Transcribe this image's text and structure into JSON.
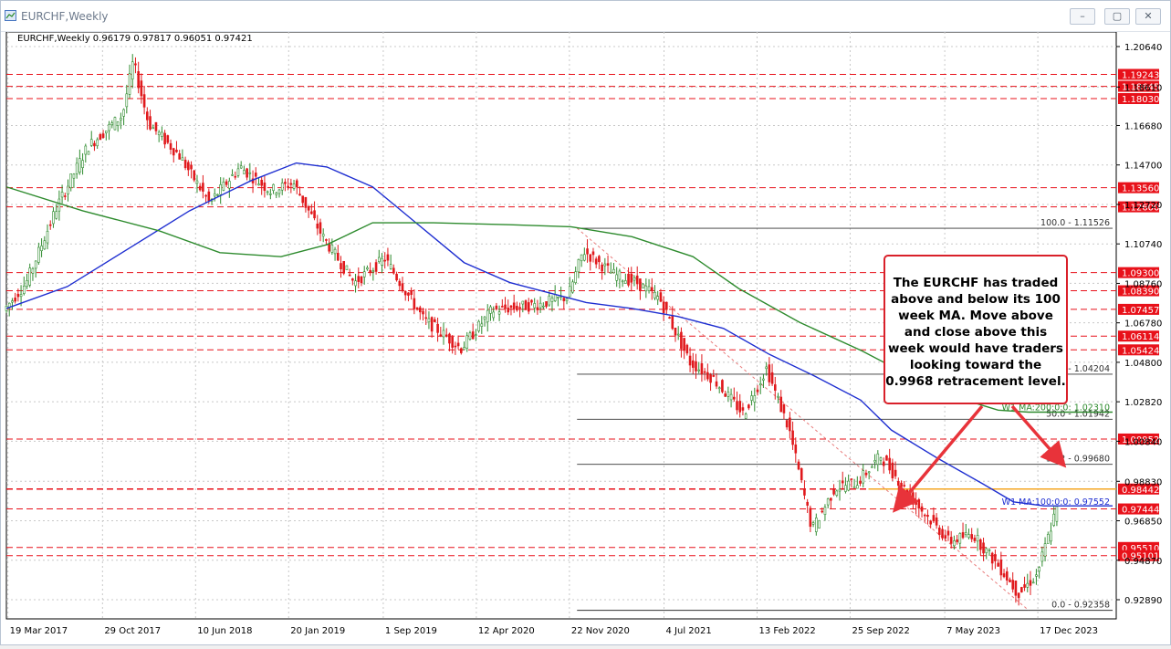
{
  "window": {
    "title": "EURCHF,Weekly",
    "minimize_label": "–",
    "maximize_label": "▢",
    "close_label": "✕"
  },
  "chart_data": {
    "type": "candlestick",
    "symbol_header": "EURCHF,Weekly  0.96179 0.97817 0.96051 0.97421",
    "ylim": [
      0.915,
      1.212
    ],
    "grid": true,
    "y_ticks": [
      "1.20640",
      "1.18610",
      "1.16680",
      "1.14700",
      "1.12720",
      "1.10740",
      "1.08760",
      "1.06780",
      "1.04800",
      "1.02820",
      "1.00840",
      "0.98830",
      "0.96850",
      "0.94870",
      "0.92890"
    ],
    "y_tick_values": [
      1.2064,
      1.1861,
      1.1668,
      1.147,
      1.1272,
      1.1074,
      1.0876,
      1.0678,
      1.048,
      1.0282,
      1.0084,
      0.9883,
      0.9685,
      0.9487,
      0.9289
    ],
    "x_ticks": [
      "19 Mar 2017",
      "29 Oct 2017",
      "10 Jun 2018",
      "20 Jan 2019",
      "1 Sep 2019",
      "12 Apr 2020",
      "22 Nov 2020",
      "4 Jul 2021",
      "13 Feb 2022",
      "25 Sep 2022",
      "7 May 2023",
      "17 Dec 2023"
    ],
    "x_tick_values": [
      2017.21,
      2017.83,
      2018.44,
      2019.05,
      2019.67,
      2020.28,
      2020.89,
      2021.51,
      2022.12,
      2022.73,
      2023.35,
      2023.96
    ],
    "x_range": [
      2017.2,
      2024.45
    ],
    "horizontal_levels": [
      {
        "label": "1.19243",
        "value": 1.19243
      },
      {
        "label": "1.18645",
        "value": 1.18645
      },
      {
        "label": "1.18030",
        "value": 1.1803
      },
      {
        "label": "1.13560",
        "value": 1.1356
      },
      {
        "label": "1.12600",
        "value": 1.126
      },
      {
        "label": "1.09300",
        "value": 1.093
      },
      {
        "label": "1.08390",
        "value": 1.0839
      },
      {
        "label": "1.07457",
        "value": 1.07457
      },
      {
        "label": "1.06114",
        "value": 1.06114
      },
      {
        "label": "1.05424",
        "value": 1.05424
      },
      {
        "label": "1.00952",
        "value": 1.00952
      },
      {
        "label": "0.98442",
        "value": 0.98442
      },
      {
        "label": "0.97444",
        "value": 0.97444
      },
      {
        "label": "0.95510",
        "value": 0.9551
      },
      {
        "label": "0.95101",
        "value": 0.95101
      }
    ],
    "fib_levels": [
      {
        "label": "100.0 - 1.11526",
        "value": 1.11526
      },
      {
        "label": "61.8 - 1.04204",
        "value": 1.04204
      },
      {
        "label": "50.0 - 1.01942",
        "value": 1.01942
      },
      {
        "label": "38.2 - 0.99680",
        "value": 0.9968
      },
      {
        "label": "0.0 - 0.92358",
        "value": 0.92358
      }
    ],
    "ma_labels": [
      {
        "label": "W1 MA:200:0:0: 1.02310",
        "value": 1.0231,
        "color": "#2e8b2e"
      },
      {
        "label": "W1 MA:100:0:0: 0.97552",
        "value": 0.97552,
        "color": "#1f2fd1"
      }
    ],
    "series": [
      {
        "name": "W1 MA:100:0:0",
        "x": [
          2017.2,
          2017.6,
          2018.0,
          2018.4,
          2018.8,
          2019.1,
          2019.3,
          2019.6,
          2019.9,
          2020.2,
          2020.5,
          2020.8,
          2021.0,
          2021.3,
          2021.6,
          2021.9,
          2022.2,
          2022.5,
          2022.8,
          2023.0,
          2023.3,
          2023.6,
          2023.8,
          2024.0,
          2024.45
        ],
        "y": [
          1.075,
          1.086,
          1.105,
          1.124,
          1.139,
          1.148,
          1.146,
          1.136,
          1.117,
          1.098,
          1.088,
          1.082,
          1.078,
          1.075,
          1.071,
          1.065,
          1.052,
          1.041,
          1.029,
          1.014,
          1.0,
          0.987,
          0.978,
          0.976,
          0.976
        ]
      },
      {
        "name": "W1 MA:200:0:0",
        "x": [
          2017.2,
          2017.7,
          2018.2,
          2018.6,
          2019.0,
          2019.3,
          2019.6,
          2020.0,
          2020.5,
          2020.9,
          2021.3,
          2021.7,
          2022.0,
          2022.4,
          2022.8,
          2023.1,
          2023.4,
          2023.7,
          2023.9,
          2024.45
        ],
        "y": [
          1.136,
          1.124,
          1.114,
          1.103,
          1.101,
          1.107,
          1.118,
          1.118,
          1.117,
          1.116,
          1.111,
          1.101,
          1.085,
          1.068,
          1.054,
          1.042,
          1.031,
          1.024,
          1.023,
          1.023
        ]
      }
    ],
    "annotation": {
      "lines": [
        "The EURCHF has traded",
        "above and below its 100",
        "week MA.  Move above",
        "and close above this",
        "week would have traders",
        "looking toward the",
        "0.9968 retracement level."
      ]
    },
    "colors": {
      "up_candle": "#2e8b2e",
      "down_candle": "#e0191c",
      "support_line": "#e8111a",
      "fib_line": "#333333",
      "ma100": "#1f2fd1",
      "ma200": "#2e8b2e",
      "highlight_level": "#f5a623",
      "annotation_border": "#d9202a",
      "arrow": "#e8333a"
    }
  }
}
